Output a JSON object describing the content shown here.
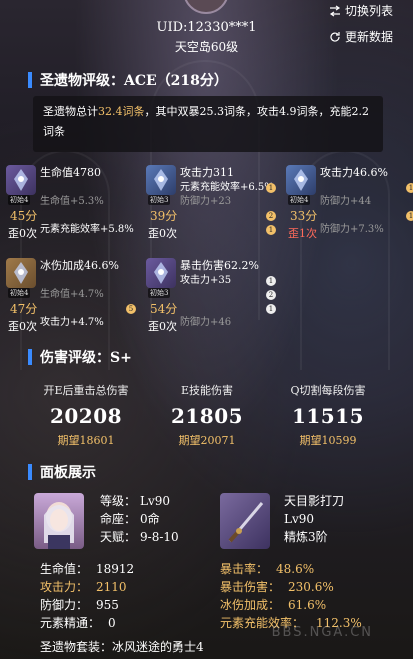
{
  "header": {
    "uid": "UID:12330***1",
    "world_level": "天空岛60级",
    "switch_list": "切换列表",
    "update_data": "更新数据"
  },
  "artifact_rating": {
    "title": "圣遗物评级：ACE（218分）",
    "summary_prefix": "圣遗物总计",
    "summary_total": "32.4词条",
    "summary_rest": "，其中双暴25.3词条，攻击4.9词条，充能2.2词条"
  },
  "artifacts": [
    {
      "icon": "flower-icon",
      "init": "初始4",
      "score": "45分",
      "grade": "歪0次",
      "grade_red": false,
      "main": "生命值4780",
      "subs": [
        {
          "text": "",
          "dim": true,
          "badge": ""
        },
        {
          "text": "生命值+5.3%",
          "dim": true,
          "badge": ""
        },
        {
          "text": "",
          "dim": true,
          "badge": ""
        },
        {
          "text": "元素充能效率+5.8%",
          "dim": false,
          "badge": ""
        }
      ]
    },
    {
      "icon": "feather-icon",
      "init": "初始3",
      "score": "39分",
      "grade": "歪0次",
      "grade_red": false,
      "main": "攻击力311",
      "subs": [
        {
          "text": "元素充能效率+6.5%",
          "dim": false,
          "badge": "1"
        },
        {
          "text": "防御力+23",
          "dim": true,
          "badge": ""
        },
        {
          "text": "",
          "dim": true,
          "badge": "2"
        },
        {
          "text": "",
          "dim": true,
          "badge": "1"
        }
      ]
    },
    {
      "icon": "sands-icon",
      "init": "初始4",
      "score": "33分",
      "grade": "歪1次",
      "grade_red": true,
      "main": "攻击力46.6%",
      "subs": [
        {
          "text": "",
          "dim": true,
          "badge": "1"
        },
        {
          "text": "防御力+44",
          "dim": true,
          "badge": ""
        },
        {
          "text": "",
          "dim": true,
          "badge": "1"
        },
        {
          "text": "防御力+7.3%",
          "dim": true,
          "badge": ""
        }
      ]
    },
    {
      "icon": "goblet-icon",
      "init": "初始4",
      "score": "47分",
      "grade": "歪0次",
      "grade_red": false,
      "main": "冰伤加成46.6%",
      "subs": [
        {
          "text": "",
          "dim": true,
          "badge": ""
        },
        {
          "text": "生命值+4.7%",
          "dim": true,
          "badge": ""
        },
        {
          "text": "",
          "dim": true,
          "badge": "5"
        },
        {
          "text": "攻击力+4.7%",
          "dim": false,
          "badge": ""
        }
      ]
    },
    {
      "icon": "circlet-icon",
      "init": "初始3",
      "score": "54分",
      "grade": "歪0次",
      "grade_red": false,
      "main": "暴击伤害62.2%",
      "subs": [
        {
          "text": "攻击力+35",
          "dim": false,
          "badge": "1"
        },
        {
          "text": "",
          "dim": true,
          "badge": "2"
        },
        {
          "text": "",
          "dim": true,
          "badge": "1"
        },
        {
          "text": "防御力+46",
          "dim": true,
          "badge": ""
        }
      ]
    }
  ],
  "damage_rating": {
    "title": "伤害评级：S+",
    "cols": [
      {
        "label": "开E后重击总伤害",
        "value": "20208",
        "expect": "期望18601"
      },
      {
        "label": "E技能伤害",
        "value": "21805",
        "expect": "期望20071"
      },
      {
        "label": "Q切割每段伤害",
        "value": "11515",
        "expect": "期望10599"
      }
    ]
  },
  "panel": {
    "title": "面板展示",
    "char": {
      "level_k": "等级：",
      "level_v": "Lv90",
      "const_k": "命座：",
      "const_v": "0命",
      "talent_k": "天赋：",
      "talent_v": "9-8-10"
    },
    "weapon": {
      "name": "天目影打刀",
      "level": "Lv90",
      "refine": "精炼3阶"
    },
    "stats_left": [
      {
        "k": "生命值：",
        "v": "18912",
        "hl": false
      },
      {
        "k": "攻击力：",
        "v": "2110",
        "hl": true
      },
      {
        "k": "防御力：",
        "v": "955",
        "hl": false
      },
      {
        "k": "元素精通：",
        "v": "0",
        "hl": false
      }
    ],
    "stats_right": [
      {
        "k": "暴击率：",
        "v": "48.6%",
        "hl": true
      },
      {
        "k": "暴击伤害：",
        "v": "230.6%",
        "hl": true
      },
      {
        "k": "冰伤加成：",
        "v": "61.6%",
        "hl": true
      },
      {
        "k": "元素充能效率：",
        "v": "112.3%",
        "hl": true
      }
    ],
    "suit": "圣遗物套装：冰风迷途的勇士4"
  },
  "watermark": "BBS.NGA.CN"
}
